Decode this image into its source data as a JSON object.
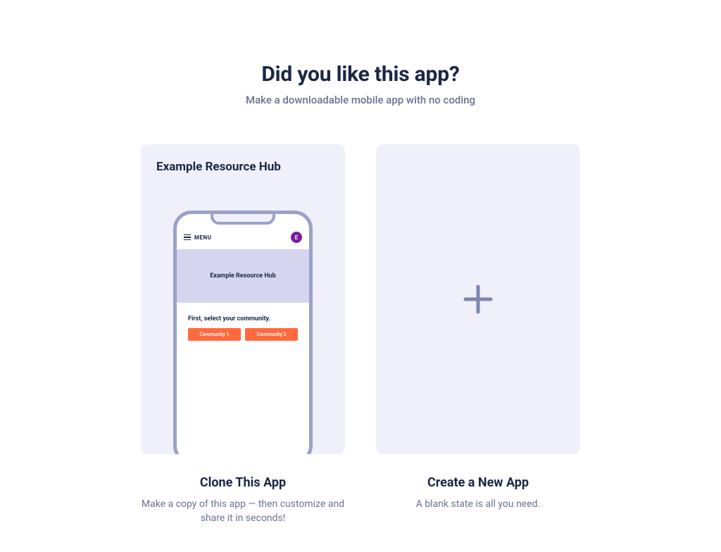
{
  "header": {
    "title": "Did you like this app?",
    "subtitle": "Make a downloadable mobile app with no coding"
  },
  "clone_card": {
    "title": "Example Resource Hub",
    "phone": {
      "menu_label": "MENU",
      "avatar_letter": "E",
      "hero_title": "Example Resource Hub",
      "section_title": "First, select your community.",
      "buttons": [
        "Community 1",
        "Community 2"
      ]
    },
    "caption_title": "Clone This App",
    "caption_body": "Make a copy of this app — then customize and share it in seconds!"
  },
  "new_card": {
    "caption_title": "Create a New App",
    "caption_body": "A blank state is all you need."
  }
}
